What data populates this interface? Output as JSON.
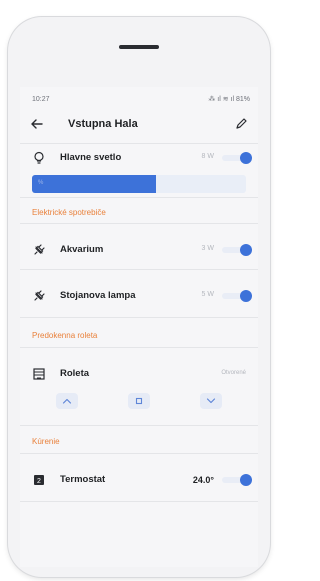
{
  "status_bar": {
    "time": "10:27",
    "indicators": "⁂ ıl ≋ ıl 81%"
  },
  "header": {
    "title": "Vstupna Hala",
    "back_icon": "arrow-left-icon",
    "edit_icon": "pencil-icon"
  },
  "main_light": {
    "icon": "lightbulb-icon",
    "label": "Hlavne svetlo",
    "power": "8 W",
    "toggle_on": true,
    "brightness": {
      "level_fraction": 0.58,
      "tick": "%"
    }
  },
  "sections": {
    "appliances": {
      "title": "Elektrické spotrebiče",
      "items": [
        {
          "icon": "plug-icon",
          "label": "Akvarium",
          "power": "3 W",
          "toggle_on": true
        },
        {
          "icon": "plug-icon",
          "label": "Stojanova lampa",
          "power": "5 W",
          "toggle_on": true
        }
      ]
    },
    "blinds": {
      "title": "Predokenna roleta",
      "item": {
        "icon": "blinds-icon",
        "label": "Roleta",
        "status": "Otvorené"
      },
      "controls": {
        "up_icon": "chevron-up-icon",
        "stop_icon": "square-stop-icon",
        "down_icon": "chevron-down-icon"
      }
    },
    "heating": {
      "title": "Kúrenie",
      "item": {
        "icon": "thermostat-icon",
        "label": "Termostat",
        "temperature": "24.0°",
        "toggle_on": true
      }
    }
  },
  "colors": {
    "accent": "#3d72d9",
    "section_title": "#e9813b",
    "background": "#f6f6f8"
  }
}
